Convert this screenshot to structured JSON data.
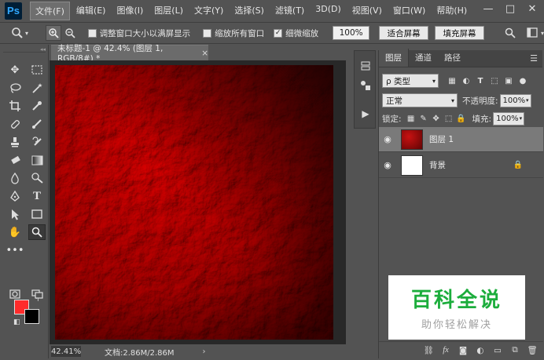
{
  "app": {
    "logo": "Ps"
  },
  "menu": [
    "文件(F)",
    "编辑(E)",
    "图像(I)",
    "图层(L)",
    "文字(Y)",
    "选择(S)",
    "滤镜(T)",
    "3D(D)",
    "视图(V)",
    "窗口(W)",
    "帮助(H)"
  ],
  "window_controls": {
    "minimize": "—",
    "maximize": "□",
    "close": "✕"
  },
  "options": {
    "resize_windows_label": "调整窗口大小以满屏显示",
    "zoom_all_label": "缩放所有窗口",
    "scrubby_zoom_label": "细微缩放",
    "zoom_percent": "100%",
    "fit_screen": "适合屏幕",
    "fill_screen": "填充屏幕"
  },
  "document": {
    "tab_title": "未标题-1 @ 42.4% (图层 1, RGB/8#) *",
    "tab_close": "×",
    "zoom_status": "42.41%",
    "doc_info": "文档:2.86M/2.86M",
    "status_arrow": "›"
  },
  "layers_panel": {
    "tabs": [
      "图层",
      "通道",
      "路径"
    ],
    "filter_label": "ρ 类型",
    "blend_mode": "正常",
    "opacity_label": "不透明度:",
    "opacity_value": "100%",
    "lock_label": "锁定:",
    "fill_label": "填充:",
    "fill_value": "100%",
    "layers": [
      {
        "name": "图层 1",
        "thumb_color": "#9a0c0c",
        "selected": true
      },
      {
        "name": "背景",
        "thumb_color": "#ffffff",
        "selected": false
      }
    ]
  },
  "colors": {
    "foreground": "#ff2b2b",
    "background": "#000000",
    "canvas_base": "#9a0c0c",
    "ui_bg": "#535353"
  },
  "watermark": {
    "title": "百科全说",
    "subtitle": "助你轻松解决"
  }
}
